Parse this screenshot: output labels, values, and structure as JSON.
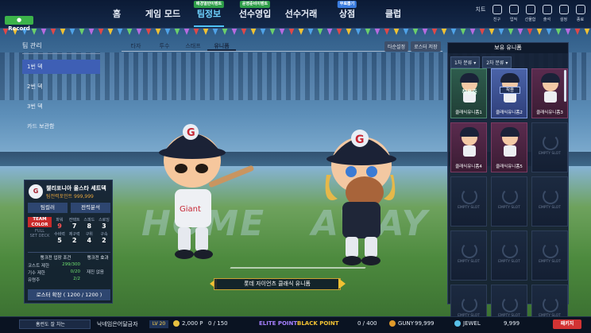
{
  "topbar": {
    "record_label": "Record",
    "nav": [
      {
        "label": "홈",
        "badge": ""
      },
      {
        "label": "게임 모드",
        "badge": ""
      },
      {
        "label": "팀정보",
        "badge": "배경열반이벤트"
      },
      {
        "label": "선수영입",
        "badge": "운영준비이벤트"
      },
      {
        "label": "선수거래",
        "badge": ""
      },
      {
        "label": "상점",
        "badge": "무료뽑기"
      },
      {
        "label": "클럽",
        "badge": ""
      }
    ],
    "badge_colors": [
      "",
      "",
      "#2e9e48",
      "#2e9e48",
      "",
      "#3b7de0",
      ""
    ],
    "right": [
      "치트",
      "친구",
      "업적",
      "선물함",
      "출석",
      "설정",
      "종료"
    ]
  },
  "sidebar": {
    "title": "팀 관리",
    "items": [
      {
        "label": "1번 덱",
        "active": true
      },
      {
        "label": "2번 덱",
        "active": false
      },
      {
        "label": "3번 덱",
        "active": false
      },
      {
        "label": "카드 보관함",
        "active": false
      }
    ]
  },
  "subtabs": {
    "items": [
      {
        "label": "타자",
        "active": false
      },
      {
        "label": "투수",
        "active": false
      },
      {
        "label": "스태프",
        "active": false
      },
      {
        "label": "유니폼",
        "active": true
      }
    ],
    "pill_1": "타순설정",
    "pill_2": "로스터 저장"
  },
  "card": {
    "logo_text": "G",
    "name": "챌리포니아 올스타 세트덱",
    "sub": "팀전력포인트 999,999",
    "btn_1": "팀컬러",
    "btn_2": "전력분석",
    "team_color_l1": "TEAM",
    "team_color_l2": "COLOR",
    "fullset_l1": "FULL",
    "fullset_l2": "SET DECK",
    "stats_row1_hdr": [
      "파워",
      "컨택트",
      "스피드",
      "스로잉"
    ],
    "stats_row1_val": [
      "9",
      "7",
      "8",
      "3"
    ],
    "stats_row2_hdr": [
      "수비력",
      "제구력",
      "구위",
      "구속"
    ],
    "stats_row2_val": [
      "5",
      "2",
      "4",
      "2"
    ],
    "cond_title": "랭크전 입장 조건",
    "eff_title": "랭크전 효과",
    "conditions": [
      {
        "label": "코스트 제한",
        "value": "299/300",
        "ok": true
      },
      {
        "label": "기수 제한",
        "value": "0/20",
        "ok": true
      },
      {
        "label": "유령주",
        "value": "2/2",
        "ok": true
      }
    ],
    "effect": "재진 없음",
    "roster": "로스터 확장 ( 1200 / 1200 )"
  },
  "center": {
    "home": "HOME",
    "away": "AWAY",
    "uniform_name": "롯데 자이언츠 클래식 유니폼"
  },
  "inventory": {
    "title": "보유 유니폼",
    "filter_1": "1차 분류",
    "filter_2": "2차 분류",
    "slots": [
      {
        "name": "클래식유니폼1",
        "state": "green",
        "tag": "착용중"
      },
      {
        "name": "클래식유니폼2",
        "state": "equipped",
        "tag": "착용"
      },
      {
        "name": "클래식유니폼3",
        "state": "filled",
        "tag": ""
      },
      {
        "name": "클래식유니폼4",
        "state": "filled",
        "tag": ""
      },
      {
        "name": "클래식유니폼5",
        "state": "filled",
        "tag": ""
      },
      {
        "name": "EMPTY SLOT",
        "state": "empty",
        "tag": ""
      },
      {
        "name": "EMPTY SLOT",
        "state": "empty",
        "tag": ""
      },
      {
        "name": "EMPTY SLOT",
        "state": "empty",
        "tag": ""
      },
      {
        "name": "EMPTY SLOT",
        "state": "empty",
        "tag": ""
      },
      {
        "name": "EMPTY SLOT",
        "state": "empty",
        "tag": ""
      },
      {
        "name": "EMPTY SLOT",
        "state": "empty",
        "tag": ""
      },
      {
        "name": "EMPTY SLOT",
        "state": "empty",
        "tag": ""
      },
      {
        "name": "EMPTY SLOT",
        "state": "empty",
        "tag": ""
      },
      {
        "name": "EMPTY SLOT",
        "state": "empty",
        "tag": ""
      },
      {
        "name": "EMPTY SLOT",
        "state": "empty",
        "tag": ""
      }
    ]
  },
  "bottombar": {
    "chat": "홈런도 잘 치는",
    "nickname": "낙네임은어달금자",
    "level_prefix": "LV",
    "level": "20",
    "p_amount": "2,000 P",
    "elite_count": "0 / 150",
    "elite_label": "ELITE POINT",
    "black_label": "BLACK POINT",
    "black_count": "0 / 400",
    "guny_label": "GUNY",
    "guny_amount": "99,999",
    "jewel_label": "JEWEL",
    "jewel_amount": "9,999",
    "shop_btn": "패키지"
  }
}
